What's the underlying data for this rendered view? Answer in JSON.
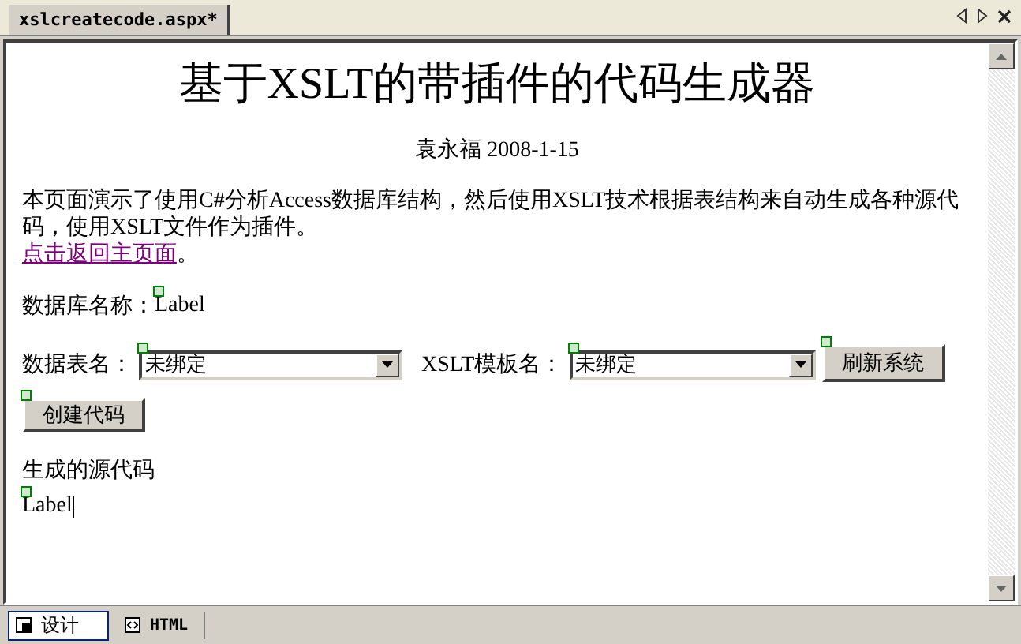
{
  "doc_tab": {
    "title": "xslcreatecode.aspx*",
    "selected": true
  },
  "page": {
    "title": "基于XSLT的带插件的代码生成器",
    "author": "袁永福 2008-1-15",
    "intro": "本页面演示了使用C#分析Access数据库结构，然后使用XSLT技术根据表结构来自动生成各种源代码，使用XSLT文件作为插件。",
    "link": "点击返回主页面",
    "link_suffix": "。",
    "db_label": "数据库名称：",
    "db_value": "Label",
    "table_label": "数据表名：",
    "table_select": "未绑定",
    "xslt_label": "XSLT模板名：",
    "xslt_select": "未绑定",
    "refresh_button": "刷新系统",
    "create_button": "创建代码",
    "output_label": "生成的源代码",
    "output_value": "Label"
  },
  "view_tabs": [
    {
      "label": "设计",
      "selected": true
    },
    {
      "label": "HTML",
      "selected": false
    }
  ]
}
